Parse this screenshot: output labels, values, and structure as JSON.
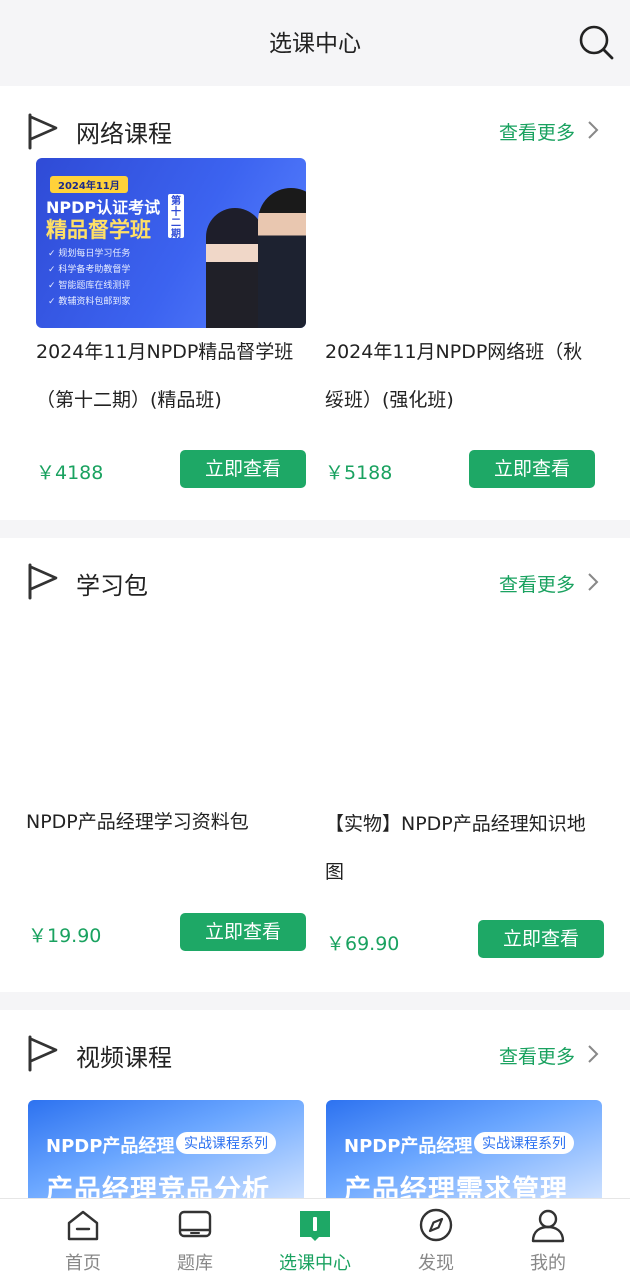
{
  "header": {
    "title": "选课中心",
    "search_icon": "search-icon"
  },
  "sections": [
    {
      "title": "网络课程",
      "more": "查看更多",
      "banner": {
        "date": "2024年11月",
        "headline": "NPDP认证考试",
        "headline2": "精品督学班",
        "tag": "第十二期",
        "bullets": [
          "规划每日学习任务",
          "科学备考助教督学",
          "智能题库在线测评",
          "教辅资料包邮到家"
        ]
      },
      "items": [
        {
          "title_l1": "2024年11月NPDP精品督学班",
          "title_l2": "（第十二期）(精品班)",
          "price": "￥4188",
          "button": "立即查看"
        },
        {
          "title_l1": "2024年11月NPDP网络班（秋",
          "title_l2": "绥班）(强化班)",
          "price": "￥5188",
          "button": "立即查看"
        }
      ]
    },
    {
      "title": "学习包",
      "more": "查看更多",
      "items": [
        {
          "title_l1": "NPDP产品经理学习资料包",
          "title_l2": "",
          "price": "￥19.90",
          "button": "立即查看"
        },
        {
          "title_l1": "【实物】NPDP产品经理知识地",
          "title_l2": "图",
          "price": "￥69.90",
          "button": "立即查看"
        }
      ]
    },
    {
      "title": "视频课程",
      "more": "查看更多",
      "banners": [
        {
          "brand": "NPDP产品经理",
          "badge": "实战课程系列",
          "big": "产品经理竞品分析"
        },
        {
          "brand": "NPDP产品经理",
          "badge": "实战课程系列",
          "big": "产品经理需求管理"
        }
      ]
    }
  ],
  "tabs": [
    {
      "label": "首页",
      "icon": "home-icon",
      "active": false
    },
    {
      "label": "题库",
      "icon": "laptop-icon",
      "active": false
    },
    {
      "label": "选课中心",
      "icon": "book-icon",
      "active": true
    },
    {
      "label": "发现",
      "icon": "compass-icon",
      "active": false
    },
    {
      "label": "我的",
      "icon": "user-icon",
      "active": false
    }
  ],
  "colors": {
    "accent": "#1aa260",
    "button": "#1ea866",
    "background": "#f5f5f7"
  }
}
